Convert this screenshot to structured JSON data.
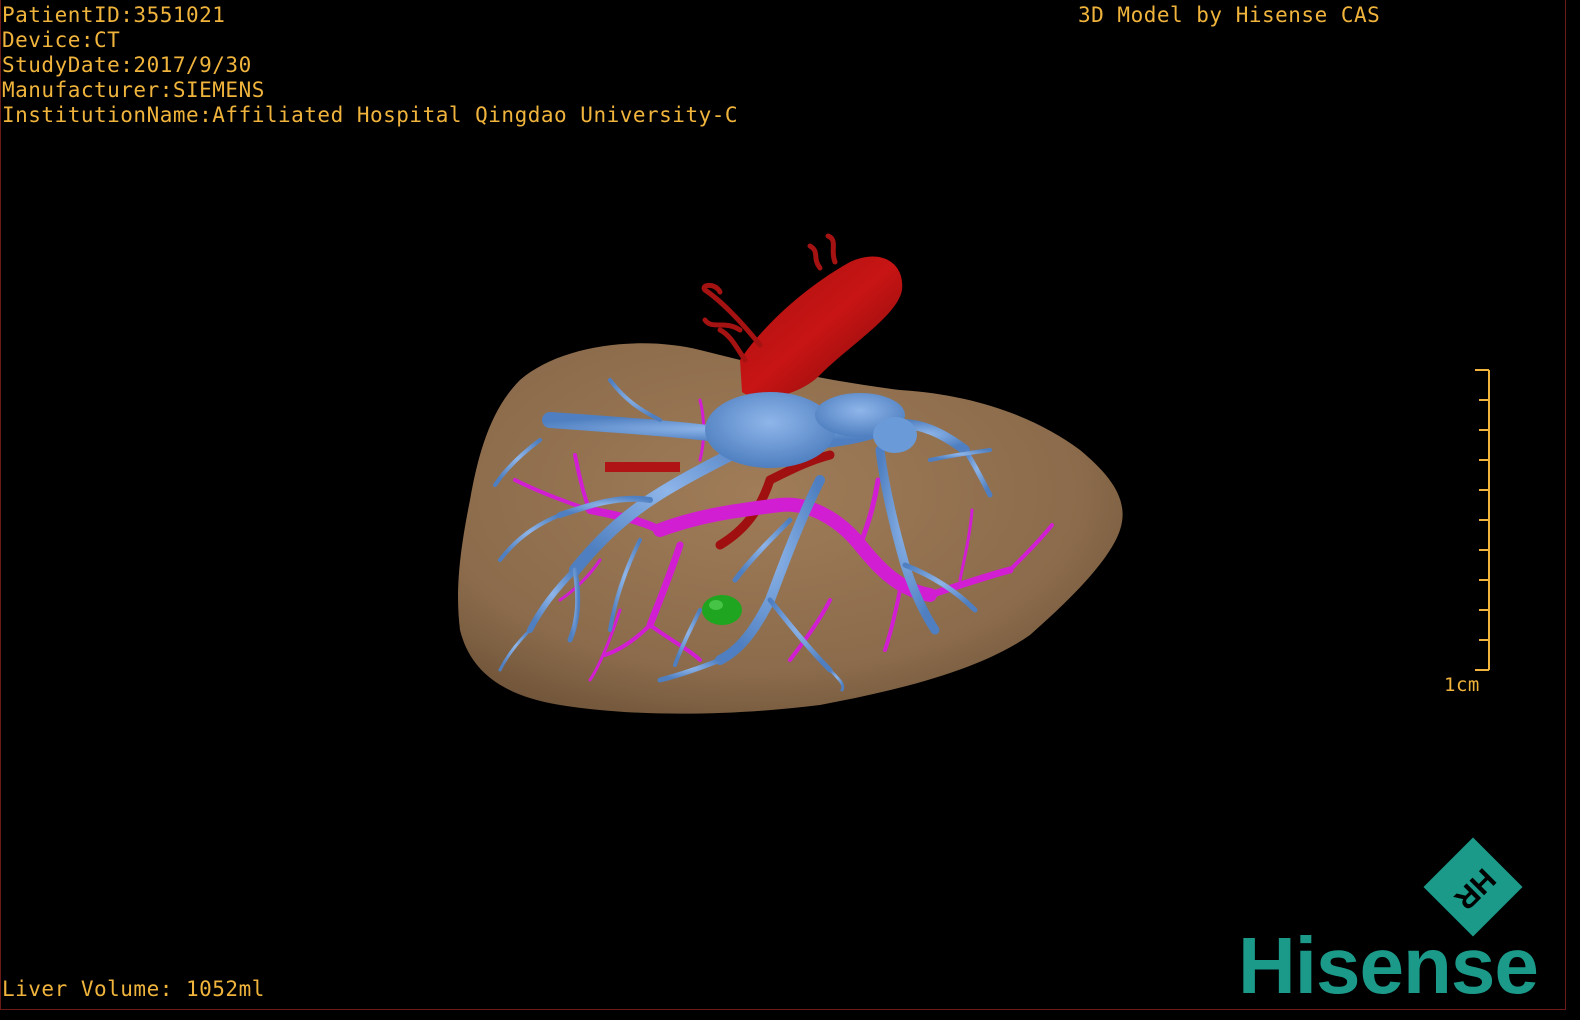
{
  "patient_info": {
    "patient_id": "PatientID:3551021",
    "device": "Device:CT",
    "study_date": "StudyDate:2017/9/30",
    "manufacturer": "Manufacturer:SIEMENS",
    "institution": "InstitutionName:Affiliated Hospital Qingdao University-C"
  },
  "model_credit": "3D Model by Hisense CAS",
  "liver_volume": "Liver Volume: 1052ml",
  "scale_bar": {
    "label": "1cm",
    "tick_count": 10,
    "color": "#f0b43c"
  },
  "logo": {
    "wordmark": "Hisense",
    "mark_letters": "HR",
    "color": "#1b9a8a"
  },
  "colors": {
    "text": "#f0b43c",
    "liver": "#8b6b4b",
    "portal_vein": "#6a9ad8",
    "hepatic_artery": "#c81414",
    "biliary": "#d21ed2",
    "lesion": "#1fa51f",
    "background": "#000000"
  }
}
